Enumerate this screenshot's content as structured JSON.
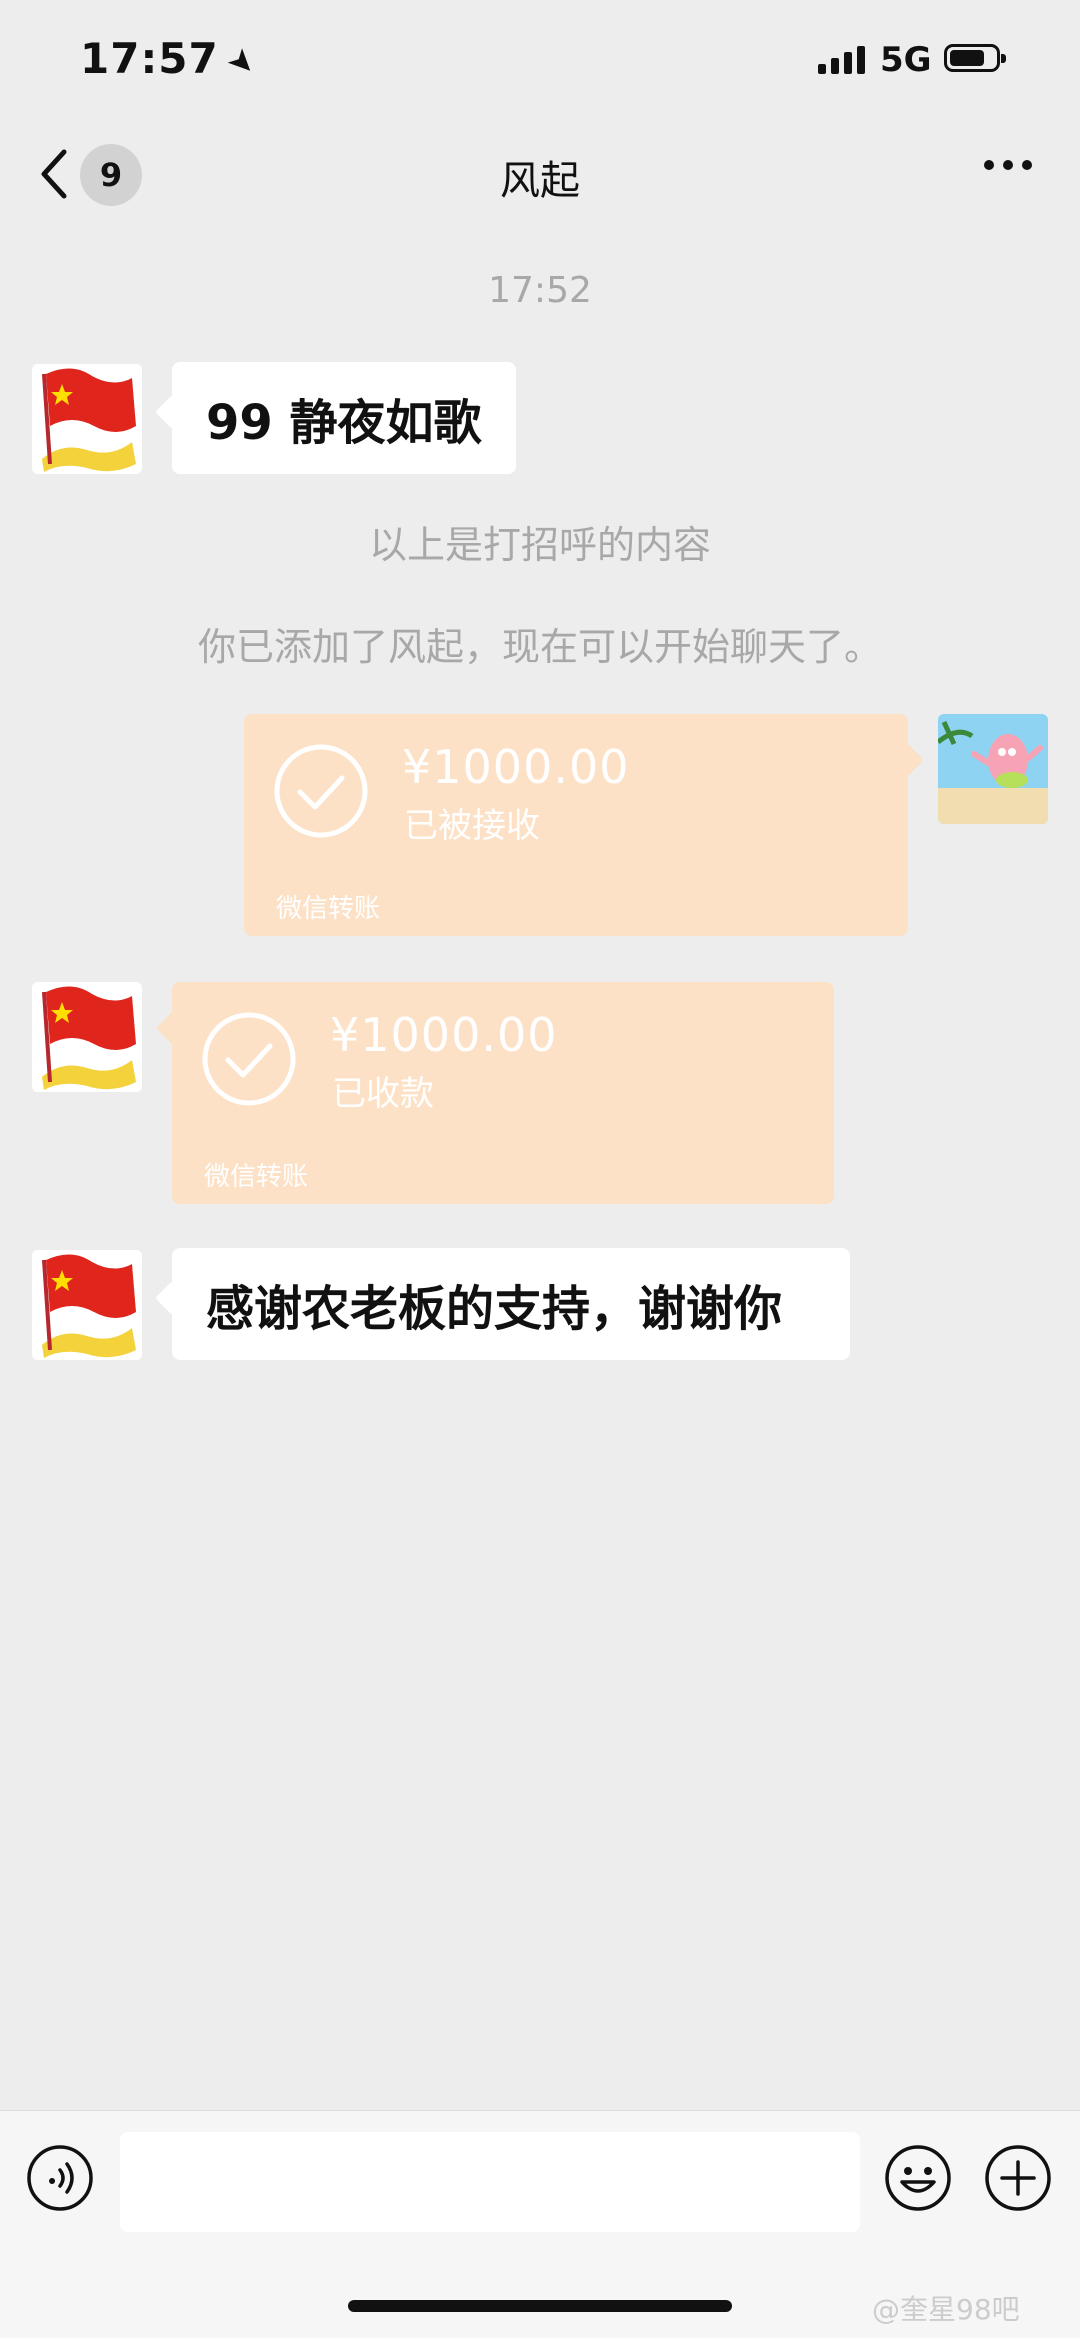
{
  "status_bar": {
    "time": "17:57",
    "network": "5G"
  },
  "nav": {
    "unread_count": "9",
    "title": "风起"
  },
  "chat": {
    "timestamp": "17:52",
    "messages": [
      {
        "text": "99 静夜如歌"
      },
      {
        "text": "感谢农老板的支持，谢谢你"
      }
    ],
    "system_messages": [
      "以上是打招呼的内容",
      "你已添加了风起，现在可以开始聊天了。"
    ],
    "transfers": [
      {
        "amount": "¥1000.00",
        "status": "已被接收",
        "label": "微信转账"
      },
      {
        "amount": "¥1000.00",
        "status": "已收款",
        "label": "微信转账"
      }
    ]
  },
  "icons": {
    "back": "chevron-left-icon",
    "more": "more-dots-icon",
    "voice": "voice-icon",
    "emoji": "emoji-icon",
    "plus": "plus-icon",
    "check": "check-circle-icon"
  },
  "watermark": "@奎星98吧",
  "colors": {
    "background": "#ededed",
    "transfer_card": "#fde1c6",
    "bubble": "#ffffff"
  }
}
